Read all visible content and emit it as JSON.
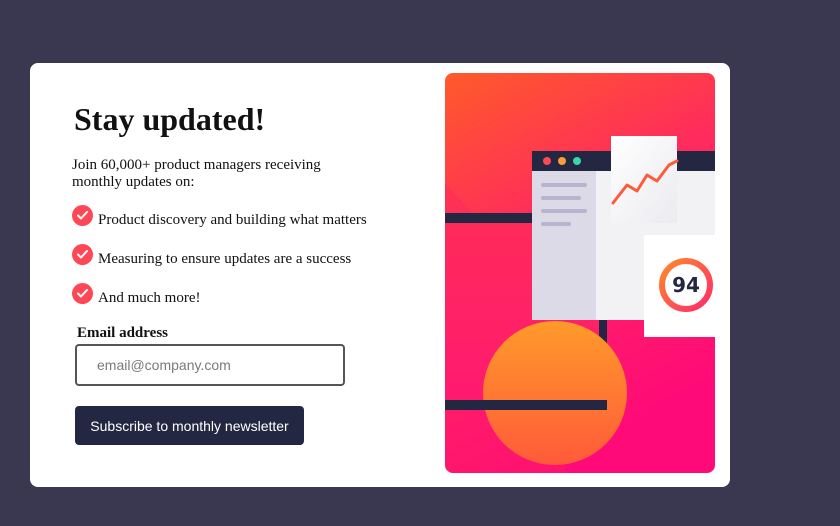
{
  "signup": {
    "title": "Stay updated!",
    "intro": "Join 60,000+ product managers receiving monthly updates on:",
    "benefits": [
      "Product discovery and building what matters",
      "Measuring to ensure updates are a success",
      "And much more!"
    ],
    "email_label": "Email address",
    "email_placeholder": "email@company.com",
    "email_value": "",
    "submit_label": "Subscribe to monthly newsletter"
  },
  "illustration": {
    "score": "94"
  },
  "colors": {
    "background": "#3a3750",
    "card": "#ffffff",
    "accent": "#ff4756",
    "button": "#242742",
    "gradient_top": "#ff5a2a",
    "gradient_bottom": "#ff1a75"
  }
}
